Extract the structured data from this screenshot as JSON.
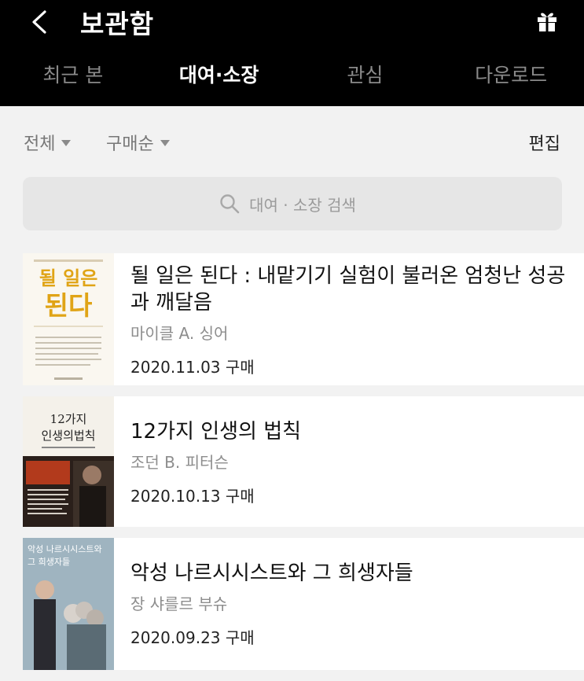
{
  "header": {
    "title": "보관함",
    "tabs": [
      "최근 본",
      "대여·소장",
      "관심",
      "다운로드"
    ],
    "active_tab": 1
  },
  "filters": {
    "scope": "전체",
    "sort": "구매순",
    "edit": "편집"
  },
  "search": {
    "placeholder": "대여 · 소장 검색"
  },
  "books": [
    {
      "cover_main": "될 일은\n된다",
      "title": "될 일은 된다 : 내맡기기 실험이 불러온 엄청난 성공과 깨달음",
      "author": "마이클 A. 싱어",
      "date": "2020.11.03 구매"
    },
    {
      "cover_main": "12가지\n인생의법칙",
      "title": "12가지 인생의 법칙",
      "author": "조던 B. 피터슨",
      "date": "2020.10.13 구매"
    },
    {
      "cover_main": "악성 나르시시스트와\n그 희생자들",
      "title": "악성 나르시시스트와 그 희생자들",
      "author": "장 샤를르 부슈",
      "date": "2020.09.23 구매"
    }
  ],
  "colors": {
    "header_bg": "#000000",
    "page_bg": "#f2f2f2",
    "cover1_title": "#e0a416"
  }
}
